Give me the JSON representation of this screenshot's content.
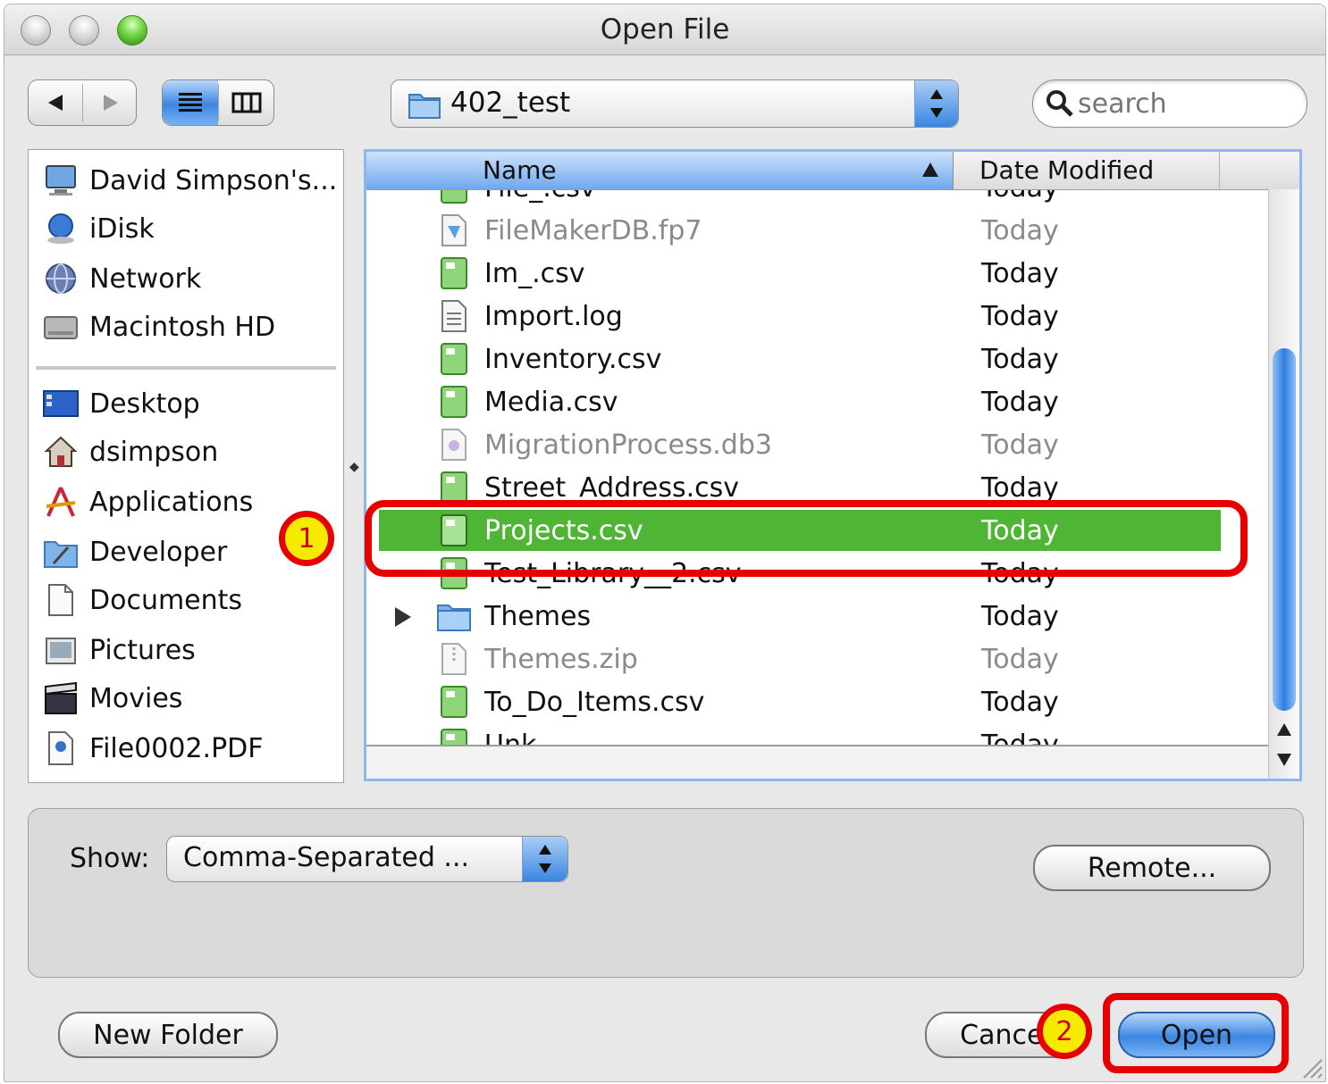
{
  "window": {
    "title": "Open File"
  },
  "toolbar": {
    "nav_back_icon": "triangle-left-icon",
    "nav_forward_icon": "triangle-right-icon",
    "view_list_icon": "list-view-icon",
    "view_column_icon": "column-view-icon",
    "location": "402_test",
    "search_placeholder": "search"
  },
  "sidebar": {
    "devices": [
      {
        "label": "David Simpson's...",
        "icon": "computer-icon"
      },
      {
        "label": "iDisk",
        "icon": "idisk-icon"
      },
      {
        "label": "Network",
        "icon": "network-globe-icon"
      },
      {
        "label": "Macintosh HD",
        "icon": "hard-drive-icon"
      }
    ],
    "places": [
      {
        "label": "Desktop",
        "icon": "desktop-icon"
      },
      {
        "label": "dsimpson",
        "icon": "home-icon"
      },
      {
        "label": "Applications",
        "icon": "applications-icon"
      },
      {
        "label": "Developer",
        "icon": "developer-folder-icon"
      },
      {
        "label": "Documents",
        "icon": "documents-icon"
      },
      {
        "label": "Pictures",
        "icon": "pictures-icon"
      },
      {
        "label": "Movies",
        "icon": "movies-clapper-icon"
      },
      {
        "label": "File0002.PDF",
        "icon": "pdf-file-icon"
      }
    ]
  },
  "browser": {
    "columns": {
      "name": "Name",
      "date": "Date Modified"
    },
    "rows": [
      {
        "name": "File_.csv",
        "date": "Today",
        "icon": "csv-file-icon"
      },
      {
        "name": "FileMakerDB.fp7",
        "date": "Today",
        "icon": "filemaker-file-icon",
        "dim": true
      },
      {
        "name": "Im_.csv",
        "date": "Today",
        "icon": "csv-file-icon"
      },
      {
        "name": "Import.log",
        "date": "Today",
        "icon": "log-file-icon"
      },
      {
        "name": "Inventory.csv",
        "date": "Today",
        "icon": "csv-file-icon"
      },
      {
        "name": "Media.csv",
        "date": "Today",
        "icon": "csv-file-icon"
      },
      {
        "name": "MigrationProcess.db3",
        "date": "Today",
        "icon": "database-file-icon",
        "dim": true
      },
      {
        "name": "Street_Address.csv",
        "date": "Today",
        "icon": "csv-file-icon"
      },
      {
        "name": "Projects.csv",
        "date": "Today",
        "icon": "csv-file-icon",
        "selected": true
      },
      {
        "name": "Test_Library__2.csv",
        "date": "Today",
        "icon": "csv-file-icon"
      },
      {
        "name": "Themes",
        "date": "Today",
        "icon": "folder-icon",
        "expandable": true
      },
      {
        "name": "Themes.zip",
        "date": "Today",
        "icon": "zip-file-icon",
        "dim": true
      },
      {
        "name": "To_Do_Items.csv",
        "date": "Today",
        "icon": "csv-file-icon"
      },
      {
        "name": "Unk...",
        "date": "Today",
        "icon": "csv-file-icon"
      }
    ]
  },
  "options": {
    "show_label": "Show:",
    "show_value": "Comma-Separated ...",
    "remote_label": "Remote..."
  },
  "footer": {
    "new_folder_label": "New Folder",
    "cancel_label": "Cancel",
    "open_label": "Open"
  },
  "annotations": {
    "step1": "1",
    "step2": "2"
  },
  "colors": {
    "selection": "#4fb535",
    "aqua_blue": "#3b86e1",
    "annotation_red": "#e60000",
    "annotation_yellow": "#f5ea00"
  }
}
